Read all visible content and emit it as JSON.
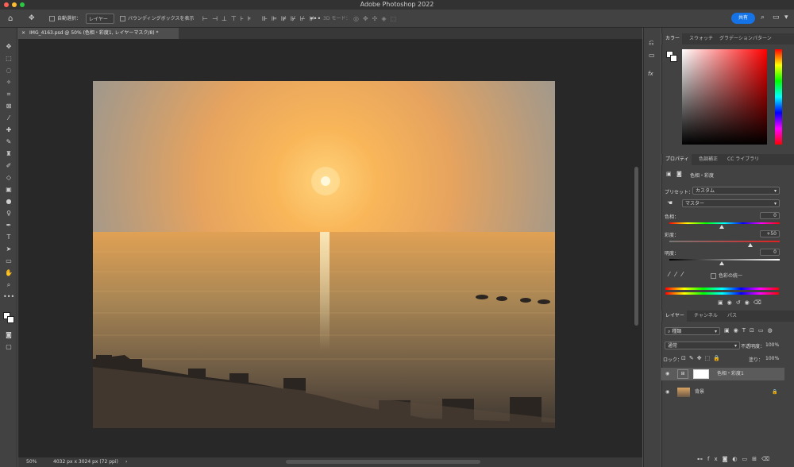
{
  "titlebar": {
    "title": "Adobe Photoshop 2022"
  },
  "options": {
    "auto_select_label": "自動選択：",
    "auto_select_value": "レイヤー",
    "bounding_box_label": "バウンディングボックスを表示",
    "mode_3d": "3D モード：",
    "share_label": "共有"
  },
  "document": {
    "tab_title": "IMG_4163.psd @ 50% (色相・彩度1, レイヤーマスク/8) *",
    "zoom": "50%",
    "dimensions": "4032 px x 3024 px (72 ppi)"
  },
  "color_panel": {
    "tabs": [
      "カラー",
      "スウォッチ",
      "グラデーション",
      "パターン"
    ]
  },
  "properties_panel": {
    "tabs": [
      "プロパティ",
      "色調補正",
      "CC ライブラリ"
    ],
    "adjustment_title": "色相・彩度",
    "preset_label": "プリセット：",
    "preset_value": "カスタム",
    "channel_value": "マスター",
    "hue_label": "色相：",
    "hue_value": "0",
    "saturation_label": "彩度：",
    "saturation_value": "+50",
    "lightness_label": "明度：",
    "lightness_value": "0",
    "colorize_label": "色彩の統一"
  },
  "layers_panel": {
    "tabs": [
      "レイヤー",
      "チャンネル",
      "パス"
    ],
    "filter_value": "種類",
    "blend_mode": "通常",
    "opacity_label": "不透明度：",
    "opacity_value": "100%",
    "lock_label": "ロック：",
    "fill_label": "塗り：",
    "fill_value": "100%",
    "layers": [
      {
        "name": "色相・彩度1"
      },
      {
        "name": "背景"
      }
    ]
  },
  "colors": {
    "accent": "#1473e6",
    "bg": "#535353",
    "panel": "#424242"
  }
}
